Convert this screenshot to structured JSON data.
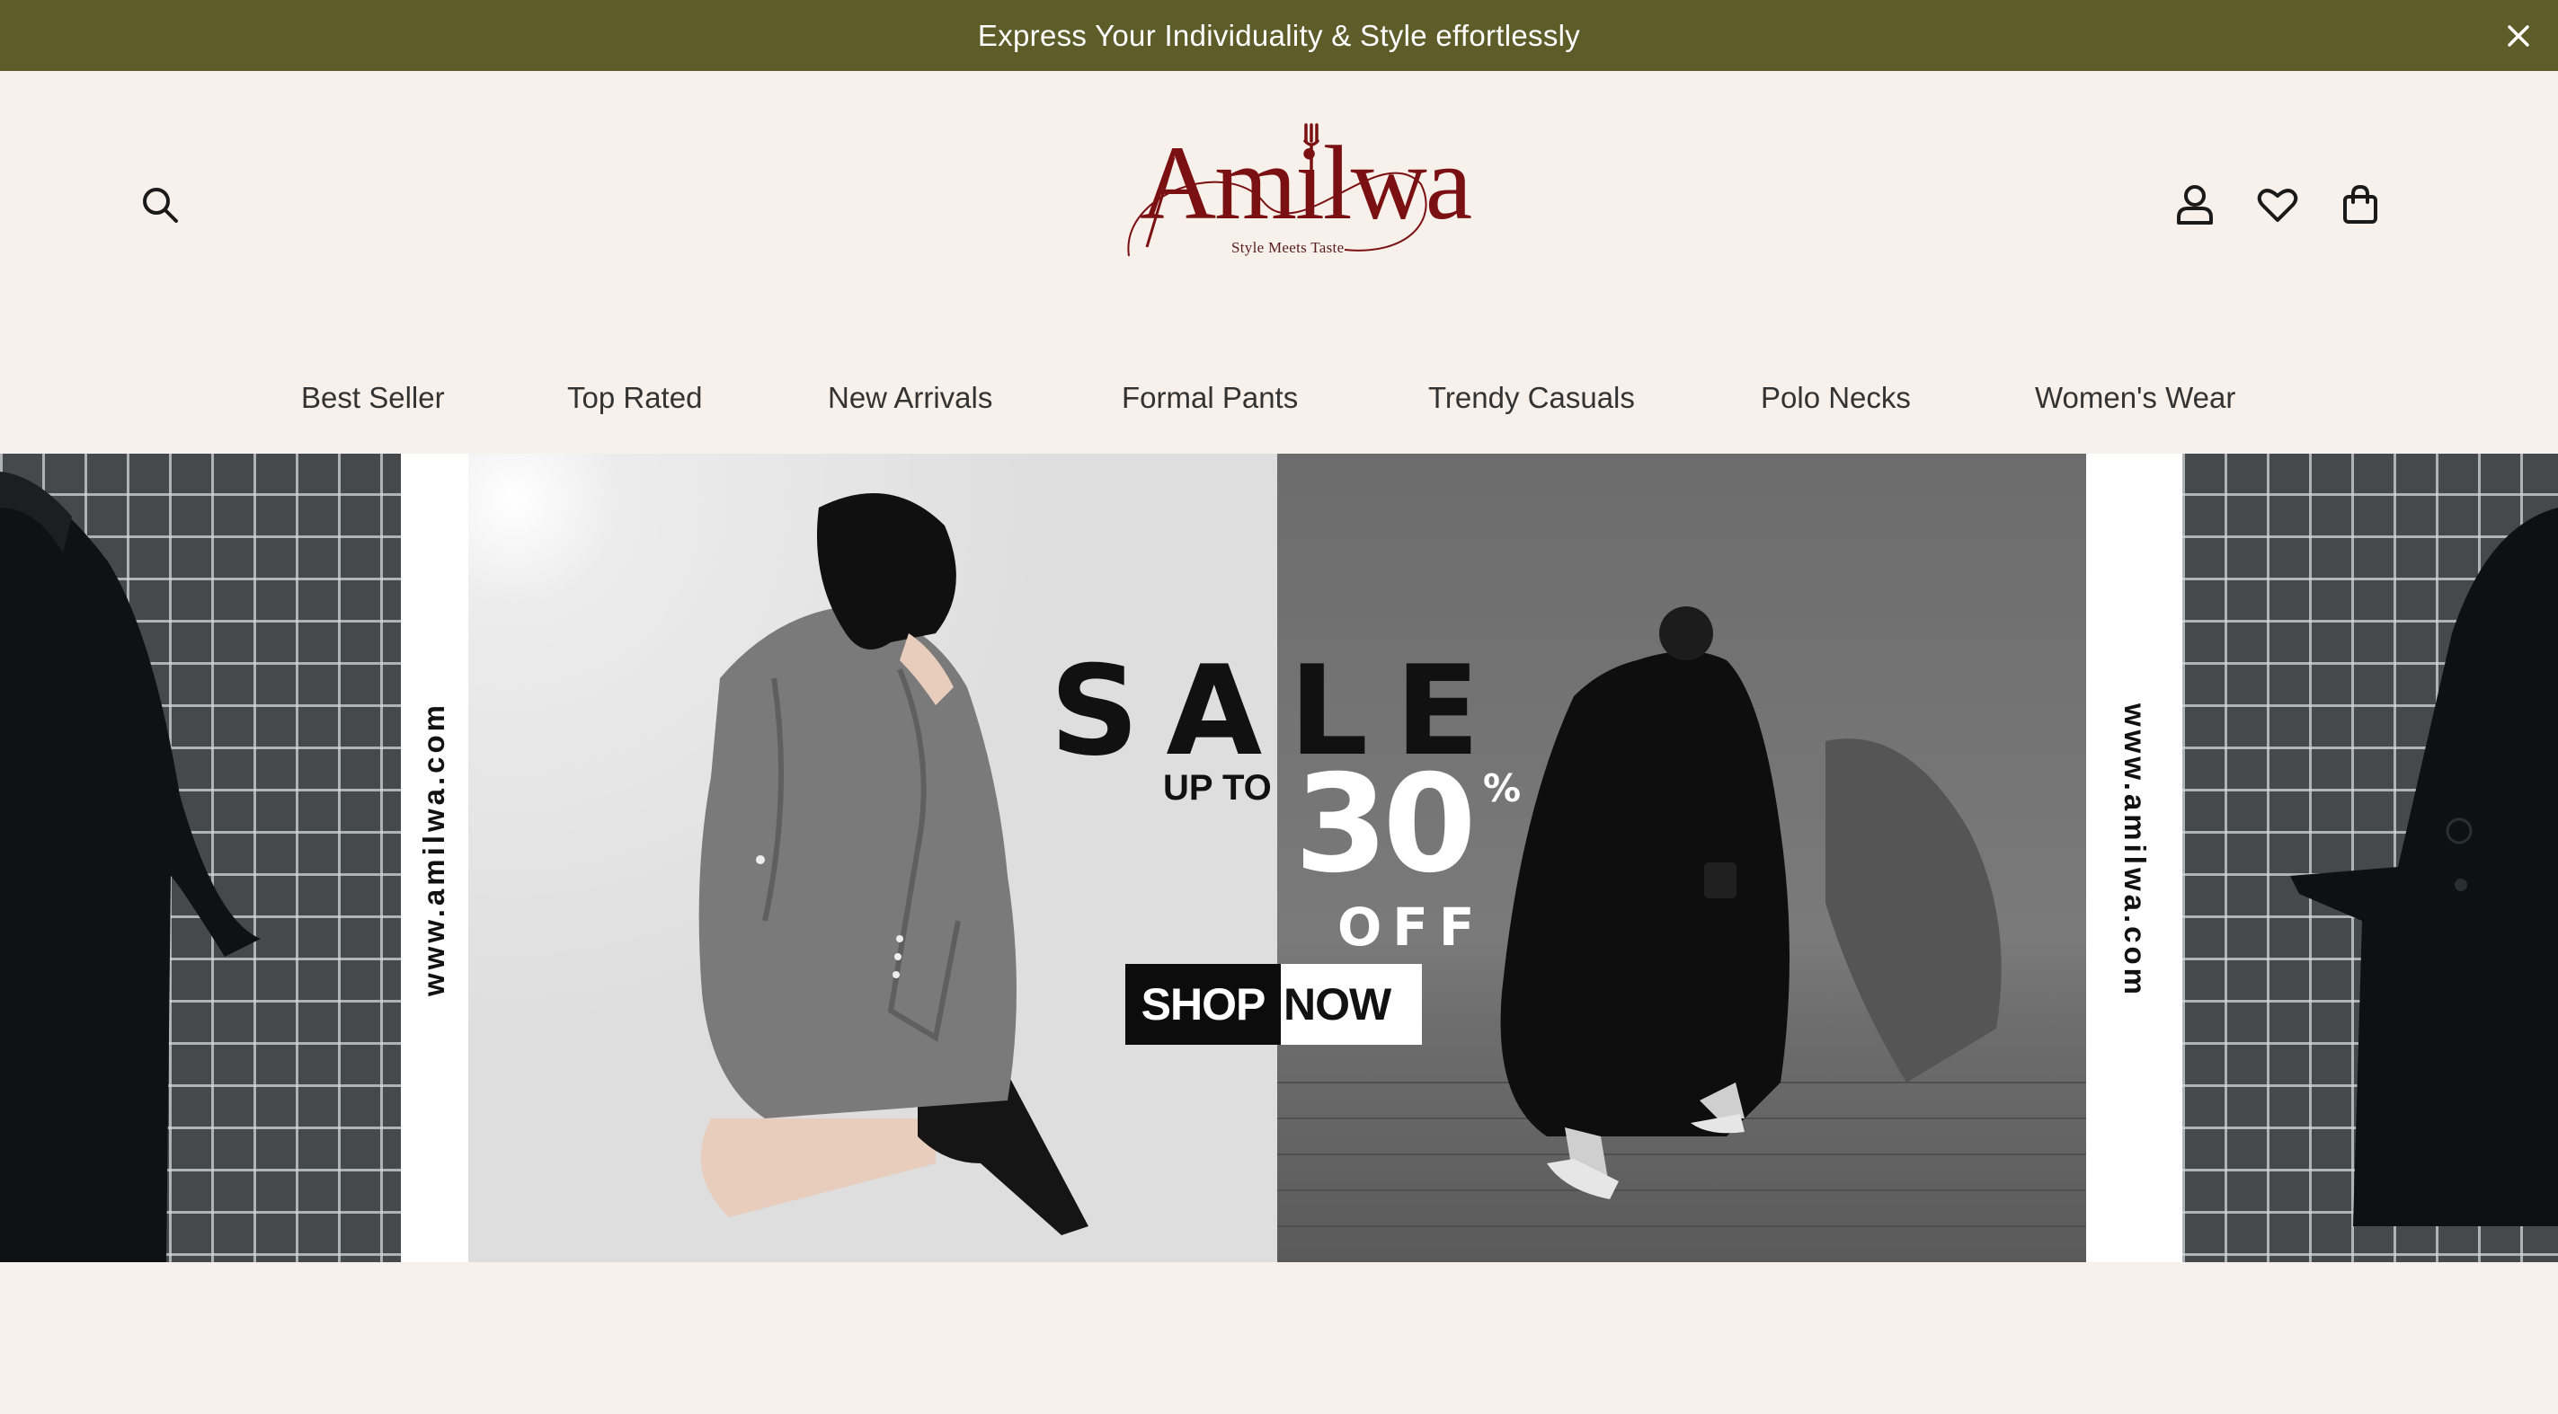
{
  "announcement": {
    "text": "Express Your Individuality & Style effortlessly"
  },
  "logo": {
    "wordmark": "Amilwa",
    "tagline": "Style Meets Taste",
    "color": "#7b1012"
  },
  "header": {
    "icons": [
      "search-icon",
      "account-icon",
      "wishlist-heart-icon",
      "shopping-bag-icon"
    ]
  },
  "nav": {
    "items": [
      {
        "label": "Best Seller"
      },
      {
        "label": "Top Rated"
      },
      {
        "label": "New Arrivals"
      },
      {
        "label": "Formal Pants"
      },
      {
        "label": "Trendy Casuals"
      },
      {
        "label": "Polo Necks"
      },
      {
        "label": "Women's Wear"
      }
    ]
  },
  "hero": {
    "website_left": "www.amilwa.com",
    "website_right": "www.amilwa.com",
    "sale": "SALE",
    "up_to": "UP TO",
    "discount_number": "30",
    "percent_sign": "%",
    "off": "OFF",
    "shop_label": "SHOP",
    "now_label": "NOW"
  },
  "colors": {
    "announcement_bg": "#5e5d2a",
    "page_bg": "#f8f0ea",
    "brand": "#7b1012"
  }
}
